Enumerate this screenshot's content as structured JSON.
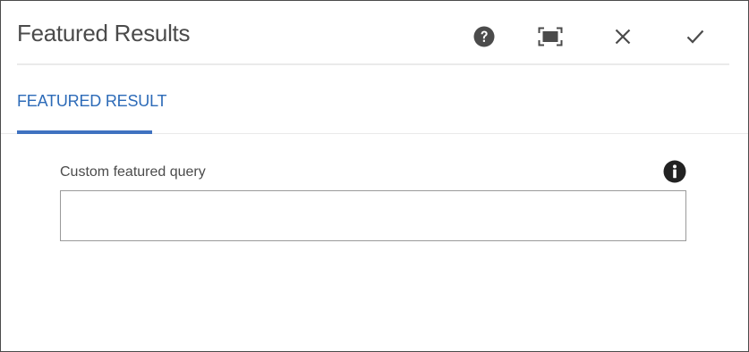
{
  "dialog": {
    "title": "Featured Results",
    "toolbar": {
      "help_icon": "help-circle-icon",
      "fullscreen_icon": "fullscreen-icon",
      "close_icon": "close-icon",
      "done_icon": "checkmark-icon"
    }
  },
  "tabs": [
    {
      "label": "FEATURED RESULT",
      "active": true
    }
  ],
  "form": {
    "custom_query": {
      "label": "Custom featured query",
      "value": "",
      "placeholder": "",
      "info_icon": "info-circle-icon"
    }
  },
  "colors": {
    "accent": "#3f72c0",
    "tab_text": "#2d6bb8",
    "text": "#4b4b4b",
    "icon": "#4b4b4b",
    "divider": "#eaeaea",
    "input_border": "#9a9a9a"
  }
}
